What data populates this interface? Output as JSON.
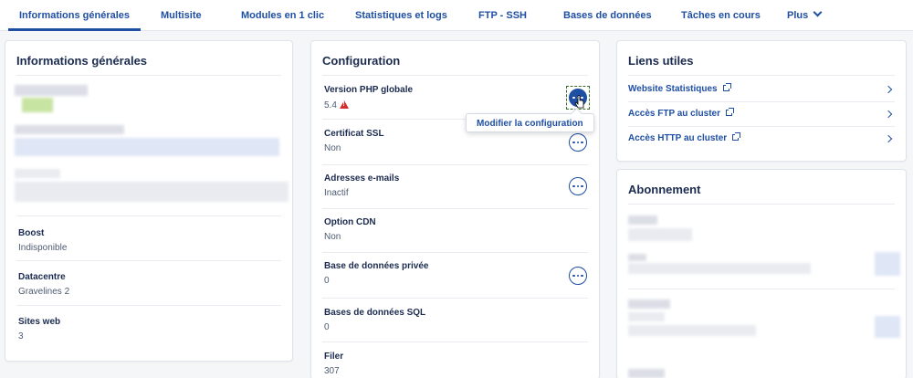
{
  "tabs": [
    {
      "label": "Informations générales",
      "active": true
    },
    {
      "label": "Multisite"
    },
    {
      "label": "Modules en 1 clic"
    },
    {
      "label": "Statistiques et logs"
    },
    {
      "label": "FTP - SSH"
    },
    {
      "label": "Bases de données"
    },
    {
      "label": "Tâches en cours"
    },
    {
      "label": "Plus"
    }
  ],
  "general": {
    "title": "Informations générales",
    "boost": {
      "label": "Boost",
      "value": "Indisponible"
    },
    "datacentre": {
      "label": "Datacentre",
      "value": "Gravelines 2"
    },
    "sites": {
      "label": "Sites web",
      "value": "3"
    }
  },
  "config": {
    "title": "Configuration",
    "php": {
      "label": "Version PHP globale",
      "value": "5.4"
    },
    "ssl": {
      "label": "Certificat SSL",
      "value": "Non"
    },
    "emails": {
      "label": "Adresses e-mails",
      "value": "Inactif"
    },
    "cdn": {
      "label": "Option CDN",
      "value": "Non"
    },
    "privatedb": {
      "label": "Base de données privée",
      "value": "0"
    },
    "sqldb": {
      "label": "Bases de données SQL",
      "value": "0"
    },
    "filer": {
      "label": "Filer",
      "value": "307"
    },
    "tooltip": "Modifier la configuration"
  },
  "links": {
    "title": "Liens utiles",
    "items": [
      "Website Statistiques",
      "Accès FTP au cluster",
      "Accès HTTP au cluster"
    ]
  },
  "subscription": {
    "title": "Abonnement"
  },
  "colors": {
    "accent": "#1f4fa3",
    "warning": "#d62d2d",
    "background": "#f5f6f8"
  },
  "icons": [
    "chevron-down-icon",
    "warning-icon",
    "more-actions-icon",
    "external-link-icon",
    "chevron-right-icon",
    "pointer-cursor-icon"
  ]
}
